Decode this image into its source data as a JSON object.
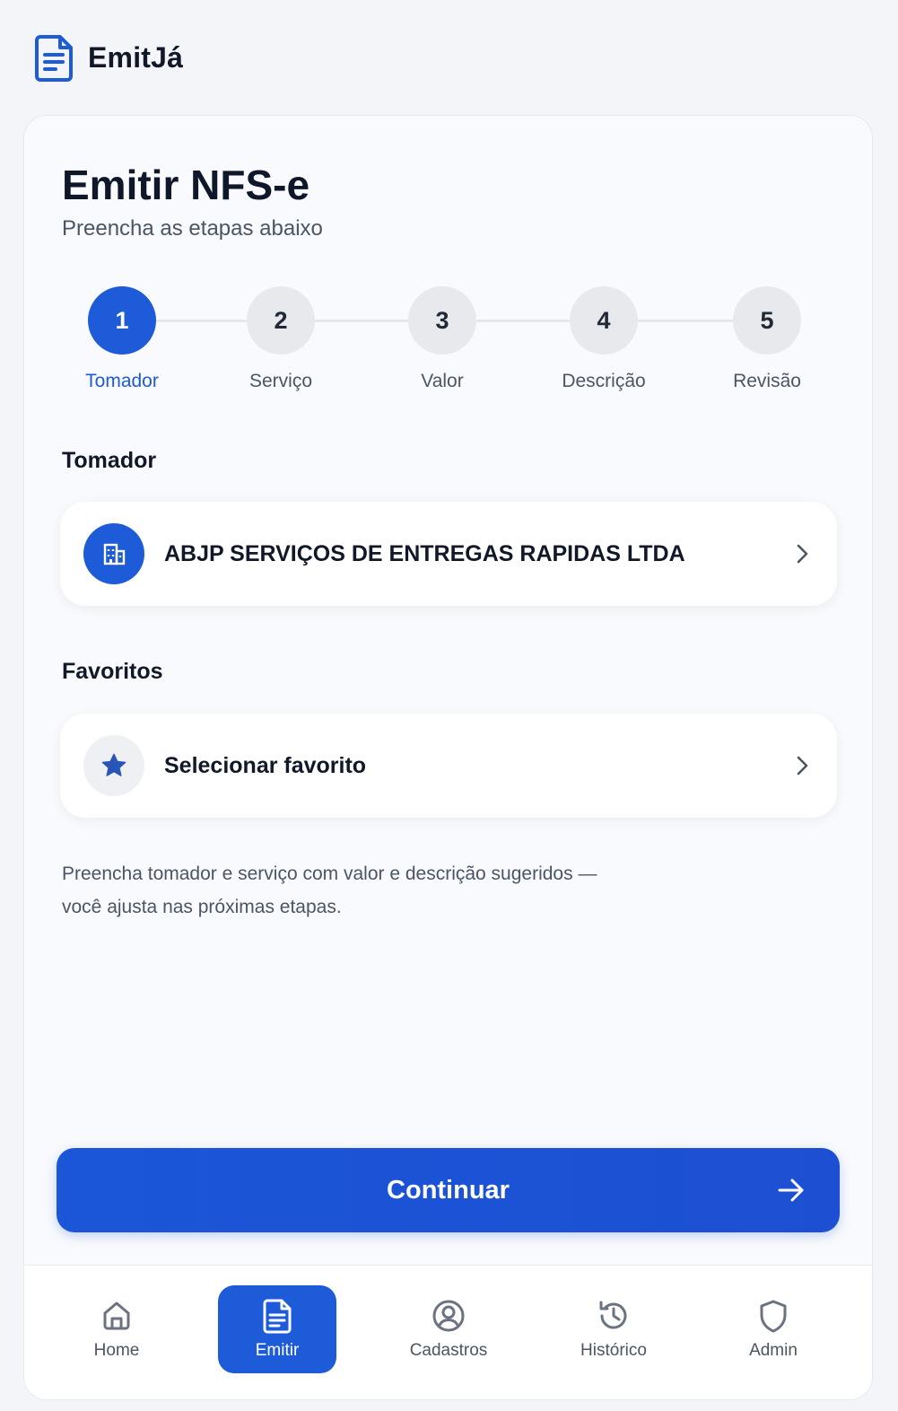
{
  "app": {
    "name": "EmitJá",
    "logo_icon": "document-icon"
  },
  "page": {
    "title": "Emitir NFS-e",
    "subtitle": "Preencha as etapas abaixo"
  },
  "stepper": {
    "steps": [
      {
        "number": "1",
        "label": "Tomador",
        "active": true
      },
      {
        "number": "2",
        "label": "Serviço",
        "active": false
      },
      {
        "number": "3",
        "label": "Valor",
        "active": false
      },
      {
        "number": "4",
        "label": "Descrição",
        "active": false
      },
      {
        "number": "5",
        "label": "Revisão",
        "active": false
      }
    ]
  },
  "tomador": {
    "section_label": "Tomador",
    "selected_name": "ABJP SERVIÇOS DE ENTREGAS RAPIDAS LTDA",
    "icon": "building-icon"
  },
  "favoritos": {
    "section_label": "Favoritos",
    "select_label": "Selecionar favorito",
    "icon": "star-icon"
  },
  "hint": {
    "line1": "Preencha tomador e serviço com valor e descrição sugeridos —",
    "line2": "você ajusta nas próximas etapas."
  },
  "actions": {
    "continue_label": "Continuar"
  },
  "bottom_nav": {
    "items": [
      {
        "label": "Home",
        "icon": "home-icon",
        "active": false
      },
      {
        "label": "Emitir",
        "icon": "document-icon",
        "active": true
      },
      {
        "label": "Cadastros",
        "icon": "user-circle-icon",
        "active": false
      },
      {
        "label": "Histórico",
        "icon": "history-icon",
        "active": false
      },
      {
        "label": "Admin",
        "icon": "shield-icon",
        "active": false
      }
    ]
  },
  "colors": {
    "accent": "#1d5bd8",
    "background": "#f3f5f9",
    "card": "#f9fafd",
    "text_primary": "#111827",
    "text_secondary": "#4b5563",
    "step_inactive": "#e8e9ec"
  }
}
